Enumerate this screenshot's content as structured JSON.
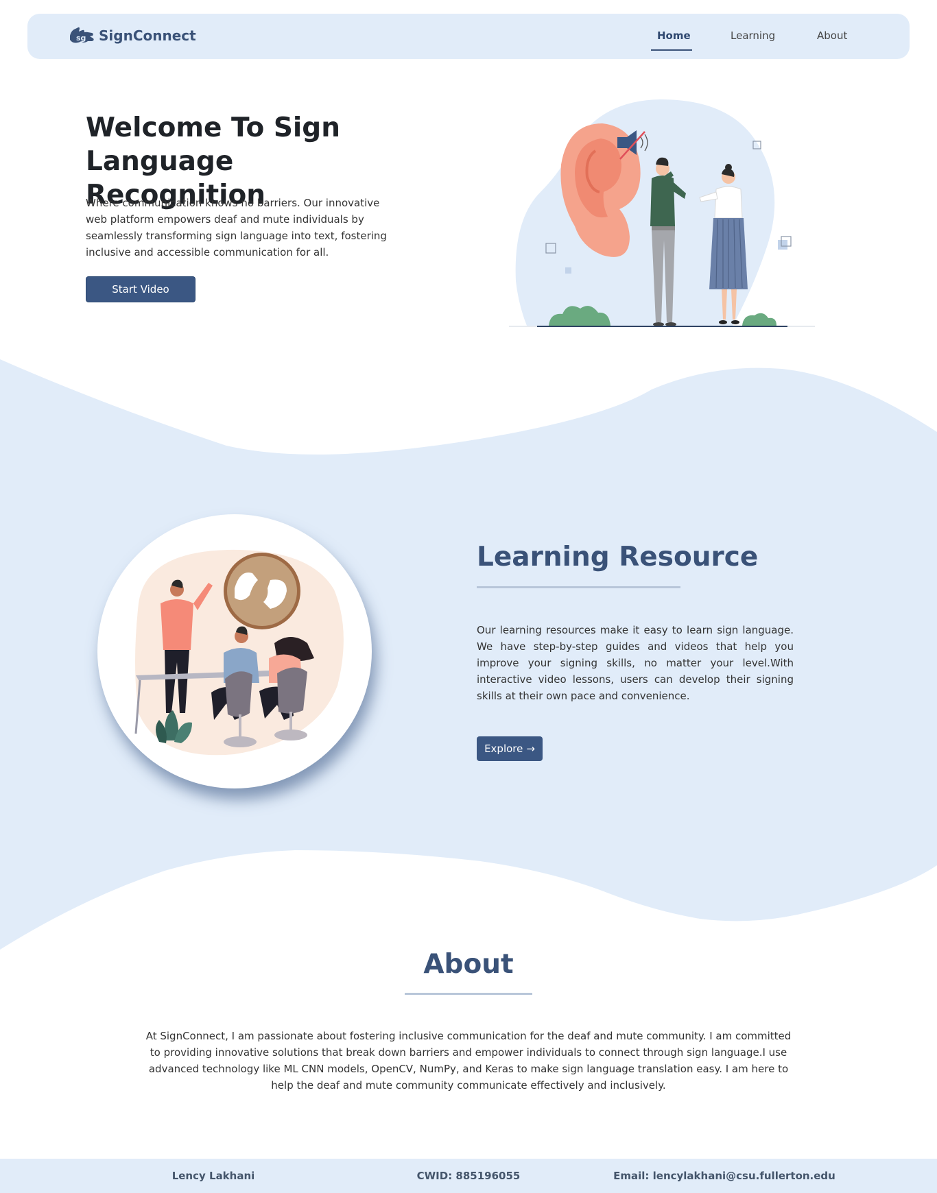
{
  "nav": {
    "brand": "SignConnect",
    "links": [
      "Home",
      "Learning",
      "About"
    ],
    "active": "Home"
  },
  "hero": {
    "title": "Welcome To Sign Language Recognition",
    "text": "Where communication knows no barriers. Our innovative web platform empowers deaf and mute individuals by seamlessly transforming sign language into text, fostering inclusive and accessible communication for all.",
    "button": "Start Video"
  },
  "learning": {
    "title": "Learning Resource",
    "text": "Our learning resources make it easy to learn sign language. We have step-by-step guides and videos that help you improve your signing skills, no matter your level.With interactive video lessons, users can develop their signing skills at their own pace and convenience.",
    "button": "Explore",
    "button_icon": "arrow-right-icon"
  },
  "about": {
    "title": "About",
    "text": "At SignConnect, I am passionate about fostering inclusive communication for the deaf and mute community. I am committed to providing innovative solutions that break down barriers and empower individuals to connect through sign language.I use advanced technology like ML CNN models, OpenCV, NumPy, and Keras to make sign language translation easy. I am here to help the deaf and mute community communicate effectively and inclusively."
  },
  "footer": {
    "name": "Lency Lakhani",
    "cwid": "CWID: 885196055",
    "email": "Email: lencylakhani@csu.fullerton.edu"
  },
  "colors": {
    "primary": "#3b5783",
    "light_bg": "#e1ecf9",
    "heading": "#3a5278"
  }
}
